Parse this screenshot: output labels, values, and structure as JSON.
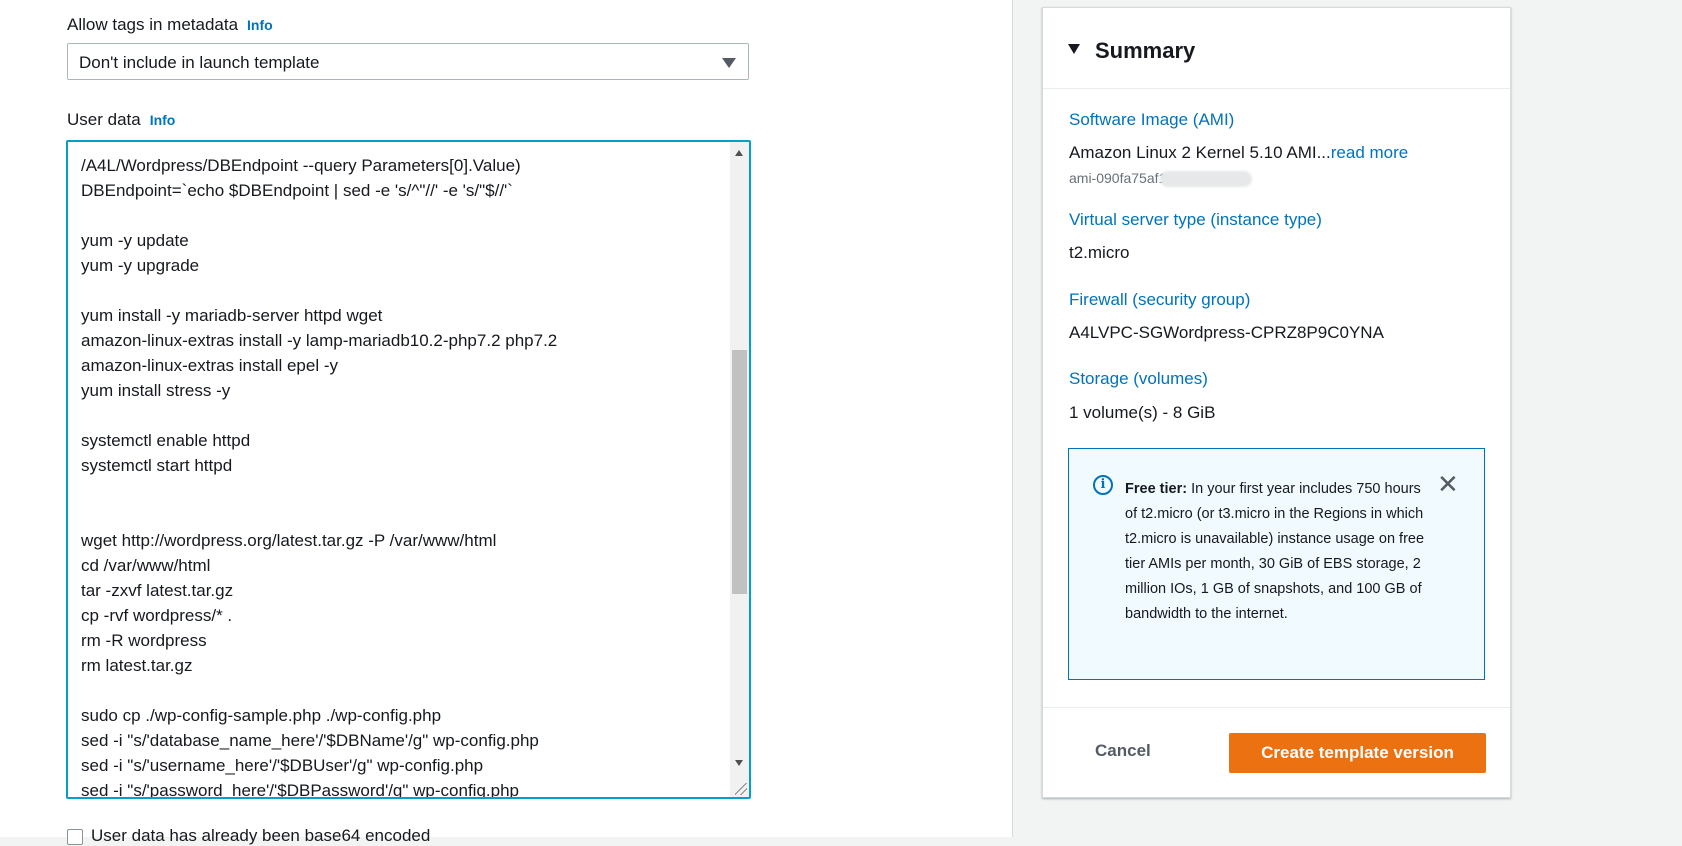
{
  "metadata_tags": {
    "label": "Allow tags in metadata",
    "info": "Info",
    "selected": "Don't include in launch template"
  },
  "user_data": {
    "label": "User data",
    "info": "Info",
    "lines": [
      "/A4L/Wordpress/DBEndpoint --query Parameters[0].Value)",
      "DBEndpoint=`echo $DBEndpoint | sed -e 's/^\"//' -e 's/\"$//'`",
      "",
      "yum -y update",
      "yum -y upgrade",
      "",
      "yum install -y mariadb-server httpd wget",
      "amazon-linux-extras install -y lamp-mariadb10.2-php7.2 php7.2",
      "amazon-linux-extras install epel -y",
      "yum install stress -y",
      "",
      "systemctl enable httpd",
      "systemctl start httpd",
      "",
      "",
      "wget http://wordpress.org/latest.tar.gz -P /var/www/html",
      "cd /var/www/html",
      "tar -zxvf latest.tar.gz",
      "cp -rvf wordpress/* .",
      "rm -R wordpress",
      "rm latest.tar.gz",
      "",
      "sudo cp ./wp-config-sample.php ./wp-config.php",
      "sed -i \"s/'database_name_here'/'$DBName'/g\" wp-config.php",
      "sed -i \"s/'username_here'/'$DBUser'/g\" wp-config.php",
      "sed -i \"s/'password_here'/'$DBPassword'/g\" wp-config.php"
    ],
    "base64_checkbox_label": "User data has already been base64 encoded"
  },
  "summary": {
    "title": "Summary",
    "ami_label": "Software Image (AMI)",
    "ami_value": "Amazon Linux 2 Kernel 5.10 AMI...",
    "ami_read_more": "read more",
    "ami_id": "ami-090fa75af1",
    "instance_type_label": "Virtual server type (instance type)",
    "instance_type_value": "t2.micro",
    "firewall_label": "Firewall (security group)",
    "firewall_value": "A4LVPC-SGWordpress-CPRZ8P9C0YNA",
    "storage_label": "Storage (volumes)",
    "storage_value": "1 volume(s) - 8 GiB",
    "free_tier_bold": "Free tier:",
    "free_tier_text": " In your first year includes 750 hours of t2.micro (or t3.micro in the Regions in which t2.micro is unavailable) instance usage on free tier AMIs per month, 30 GiB of EBS storage, 2 million IOs, 1 GB of snapshots, and 100 GB of bandwidth to the internet.",
    "cancel_label": "Cancel",
    "create_label": "Create template version"
  },
  "colors": {
    "accent": "#0073bb",
    "primary_button": "#ec7211",
    "focus_border": "#00a1c9"
  }
}
